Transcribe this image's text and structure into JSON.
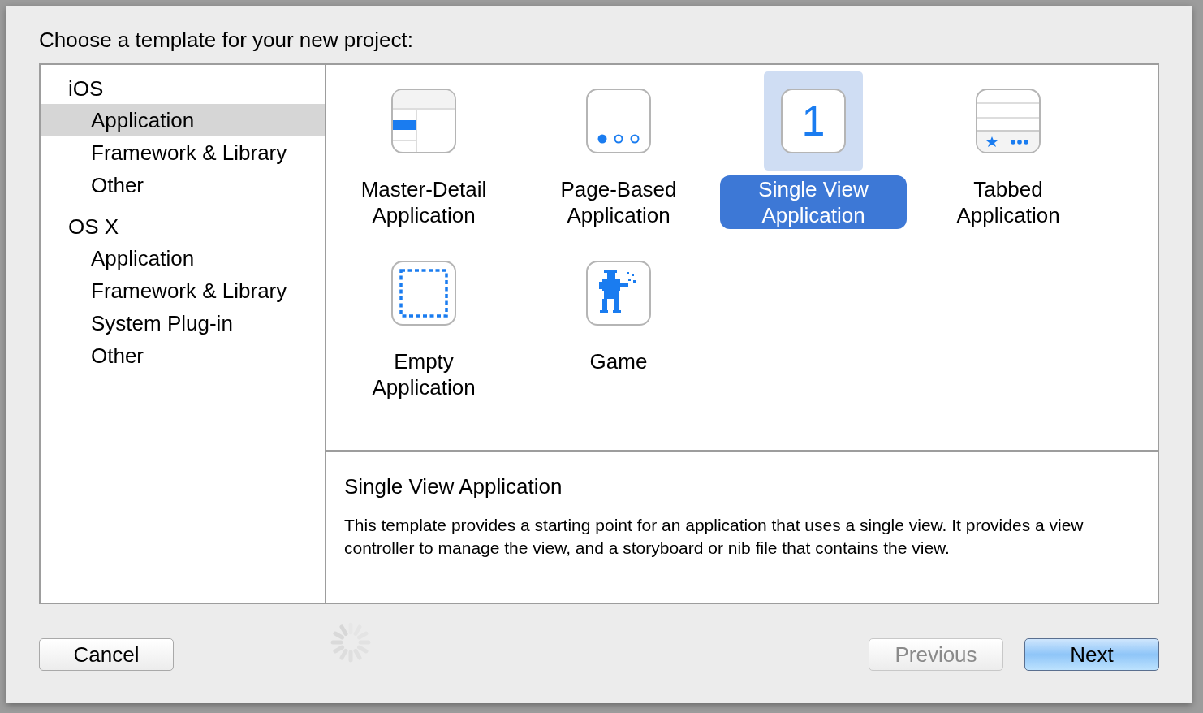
{
  "title": "Choose a template for your new project:",
  "sidebar": {
    "groups": [
      {
        "label": "iOS",
        "items": [
          {
            "label": "Application",
            "selected": true
          },
          {
            "label": "Framework & Library",
            "selected": false
          },
          {
            "label": "Other",
            "selected": false
          }
        ]
      },
      {
        "label": "OS X",
        "items": [
          {
            "label": "Application",
            "selected": false
          },
          {
            "label": "Framework & Library",
            "selected": false
          },
          {
            "label": "System Plug-in",
            "selected": false
          },
          {
            "label": "Other",
            "selected": false
          }
        ]
      }
    ]
  },
  "templates": [
    {
      "kind": "master-detail",
      "label": "Master-Detail Application",
      "selected": false
    },
    {
      "kind": "page-based",
      "label": "Page-Based Application",
      "selected": false
    },
    {
      "kind": "single-view",
      "label": "Single View Application",
      "icon_text": "1",
      "selected": true
    },
    {
      "kind": "tabbed",
      "label": "Tabbed Application",
      "selected": false
    },
    {
      "kind": "empty",
      "label": "Empty Application",
      "selected": false
    },
    {
      "kind": "game",
      "label": "Game",
      "selected": false
    }
  ],
  "description": {
    "title": "Single View Application",
    "body": "This template provides a starting point for an application that uses a single view. It provides a view controller to manage the view, and a storyboard or nib file that contains the view."
  },
  "buttons": [
    {
      "kind": "normal",
      "label": "Cancel",
      "disabled": false
    },
    {
      "kind": "normal",
      "label": "Previous",
      "disabled": true
    },
    {
      "kind": "default",
      "label": "Next",
      "disabled": false
    }
  ]
}
